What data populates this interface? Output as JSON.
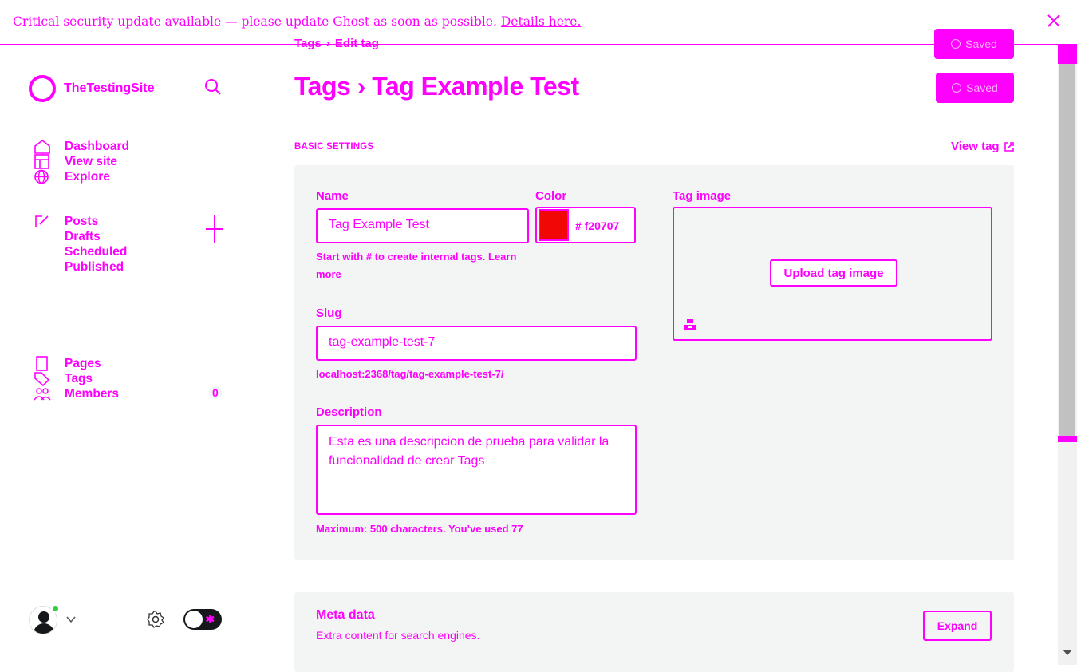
{
  "banner": {
    "message": "Critical security update available — please update Ghost as soon as possible.",
    "link": "Details here."
  },
  "sidebar": {
    "site_name": "TheTestingSite",
    "items": [
      {
        "label": "Dashboard"
      },
      {
        "label": "View site"
      },
      {
        "label": "Explore"
      },
      {
        "label": "Posts"
      },
      {
        "label": "Drafts"
      },
      {
        "label": "Scheduled"
      },
      {
        "label": "Published"
      },
      {
        "label": "Pages"
      },
      {
        "label": "Tags"
      },
      {
        "label": "Members",
        "count": "0"
      }
    ]
  },
  "header": {
    "breadcrumb_root": "Tags",
    "breadcrumb_sep": "›",
    "breadcrumb_current": "Edit tag",
    "title": "Tags › Tag Example Test",
    "save_label": "Saved"
  },
  "basic": {
    "section_label": "BASIC SETTINGS",
    "view_tag": "View tag",
    "name_label": "Name",
    "name_value": "Tag Example Test",
    "name_hint_line1": "Start with # to create internal tags. Learn",
    "name_hint_line2": "more",
    "color_label": "Color",
    "color_hex": "# f20707",
    "color_value": "#f20707",
    "slug_label": "Slug",
    "slug_value": "tag-example-test-7",
    "slug_url": "localhost:2368/tag/tag-example-test-7/",
    "description_label": "Description",
    "description_value": "Esta es una descripcion de prueba para validar la funcionalidad de crear Tags",
    "description_hint": "Maximum: 500 characters. You’ve used 77",
    "image_label": "Tag image",
    "upload_label": "Upload tag image"
  },
  "meta": {
    "title": "Meta data",
    "subtitle": "Extra content for search engines.",
    "expand_label": "Expand"
  }
}
